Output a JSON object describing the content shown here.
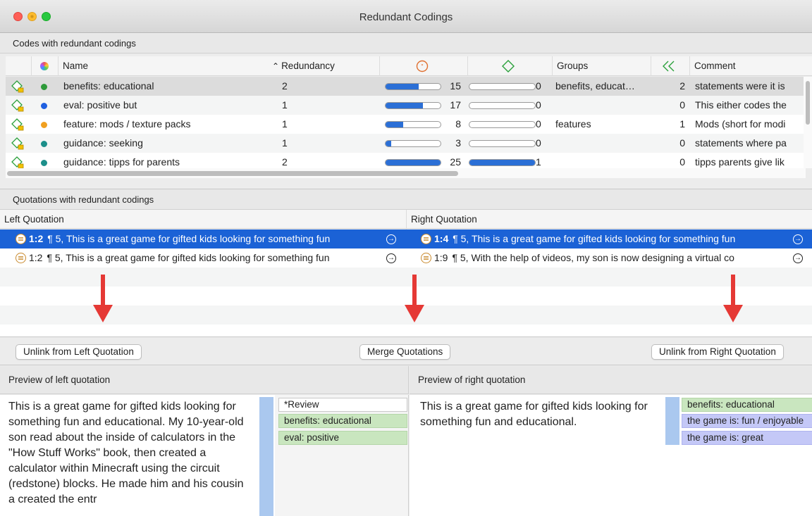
{
  "window": {
    "title": "Redundant Codings"
  },
  "codes_section": {
    "title": "Codes with redundant codings",
    "columns": {
      "name": "Name",
      "sort_indicator": "^",
      "redundancy": "Redundancy",
      "groups": "Groups",
      "comment": "Comment"
    },
    "rows": [
      {
        "name": "benefits: educational",
        "redundancy": "2",
        "count1": "15",
        "fill1": 0.6,
        "count2": "0",
        "fill2": 0,
        "groups": "benefits, educat…",
        "count3": "2",
        "comment": "statements were  it is",
        "dot_color": "#2e9a3a"
      },
      {
        "name": "eval: positive but",
        "redundancy": "1",
        "count1": "17",
        "fill1": 0.68,
        "count2": "0",
        "fill2": 0,
        "groups": "",
        "count3": "0",
        "comment": "This either codes the",
        "dot_color": "#1f5fe0"
      },
      {
        "name": "feature: mods / texture packs",
        "redundancy": "1",
        "count1": "8",
        "fill1": 0.32,
        "count2": "0",
        "fill2": 0,
        "groups": "features",
        "count3": "1",
        "comment": "Mods (short for modi",
        "dot_color": "#f0a020"
      },
      {
        "name": "guidance: seeking",
        "redundancy": "1",
        "count1": "3",
        "fill1": 0.1,
        "count2": "0",
        "fill2": 0,
        "groups": "",
        "count3": "0",
        "comment": "statements where pa",
        "dot_color": "#1c8f8a"
      },
      {
        "name": "guidance: tipps for parents",
        "redundancy": "2",
        "count1": "25",
        "fill1": 1.0,
        "count2": "1",
        "fill2": 1.0,
        "groups": "",
        "count3": "0",
        "comment": "tipps parents give lik",
        "dot_color": "#1c8f8a"
      }
    ]
  },
  "quotations_section": {
    "title": "Quotations with redundant codings",
    "left_header": "Left Quotation",
    "right_header": "Right Quotation",
    "rows": [
      {
        "left_id": "1:2",
        "left_text": "¶ 5, This is a great game for gifted kids looking for something fun",
        "right_id": "1:4",
        "right_text": "¶ 5, This is a great game for gifted kids looking for something fun"
      },
      {
        "left_id": "1:2",
        "left_text": "¶ 5, This is a great game for gifted kids looking for something fun",
        "right_id": "1:9",
        "right_text": "¶ 5, With the help of videos, my son is now designing a virtual co"
      }
    ]
  },
  "buttons": {
    "unlink_left": "Unlink from Left Quotation",
    "merge": "Merge Quotations",
    "unlink_right": "Unlink from Right Quotation"
  },
  "preview_left": {
    "title": "Preview of left quotation",
    "text": "This is a great game for gifted kids looking for something fun and educational. My 10-year-old son read about the inside of calculators in the \"How Stuff Works\" book, then created a calculator within Minecraft using the circuit (redstone) blocks. He made him and his cousin a created the entr",
    "tags": [
      "*Review",
      "benefits: educational",
      "eval: positive"
    ]
  },
  "preview_right": {
    "title": "Preview of right quotation",
    "text": "This is a great game for gifted kids looking for something fun and educational.",
    "tags": [
      "benefits: educational",
      "the game is: fun / enjoyable",
      "the game is: great"
    ]
  },
  "colors": {
    "selection": "#1b62d6",
    "arrow": "#e53935",
    "bar": "#2b6fd6",
    "tag_green": "#c9e6bf",
    "tag_blue": "#c4c8f7"
  }
}
